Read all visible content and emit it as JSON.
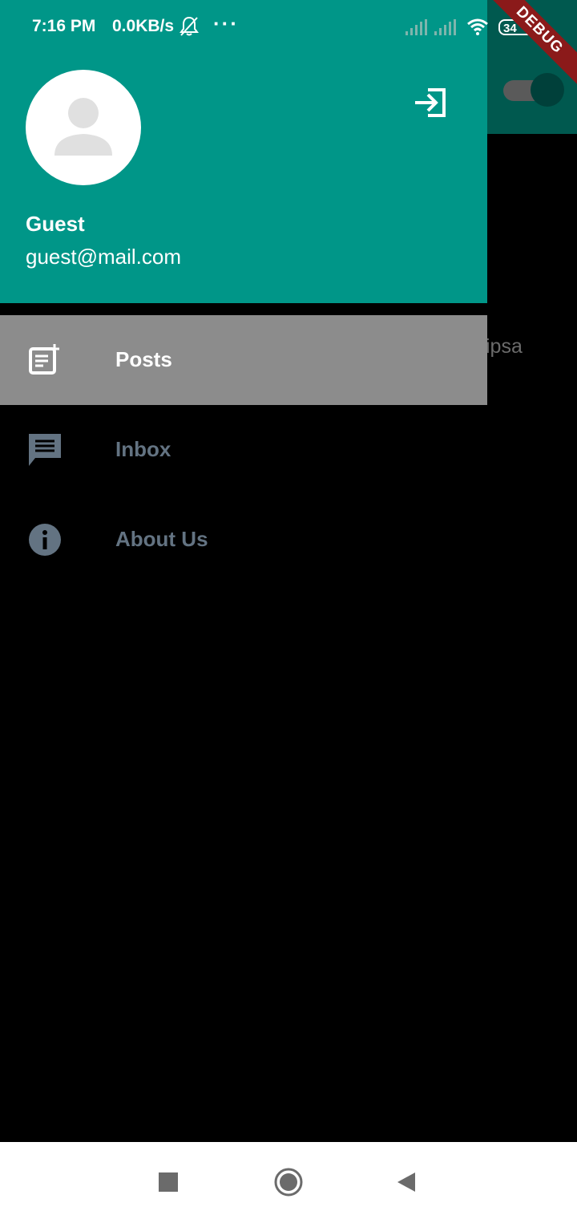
{
  "status_bar": {
    "time": "7:16 PM",
    "speed": "0.0KB/s",
    "dots": "···",
    "battery": "34"
  },
  "debug_banner": "DEBUG",
  "background": {
    "partial_text": "ipsa"
  },
  "drawer": {
    "header": {
      "name": "Guest",
      "email": "guest@mail.com",
      "color": "#009688"
    },
    "items": [
      {
        "label": "Posts",
        "icon": "post-add-icon",
        "selected": true
      },
      {
        "label": "Inbox",
        "icon": "chat-icon",
        "selected": false
      },
      {
        "label": "About Us",
        "icon": "info-icon",
        "selected": false
      }
    ]
  },
  "nav_bar": {
    "buttons": [
      "recents-icon",
      "home-icon",
      "back-icon"
    ]
  }
}
